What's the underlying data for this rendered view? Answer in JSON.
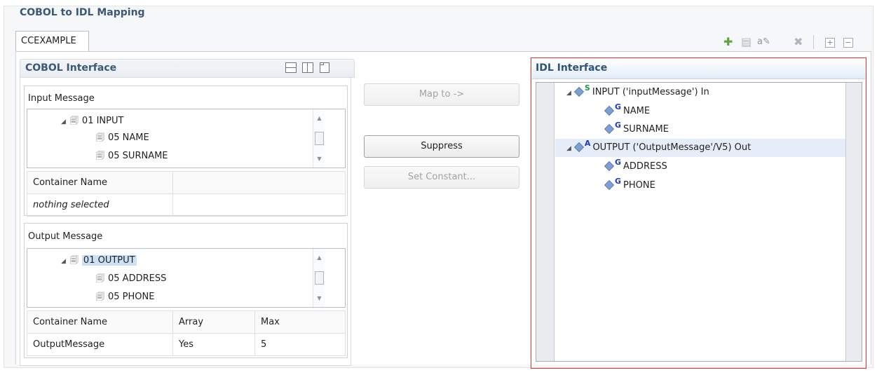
{
  "app": {
    "title": "COBOL to IDL Mapping"
  },
  "tabs": [
    {
      "label": "CCEXAMPLE"
    }
  ],
  "toolbar": {
    "icons": [
      "add-icon",
      "copy-icon",
      "rename-icon",
      "delete-icon",
      "expand-all-icon",
      "collapse-all-icon"
    ]
  },
  "cobol": {
    "title": "COBOL Interface",
    "input_message": {
      "label": "Input Message",
      "tree": [
        {
          "text": "01 INPUT",
          "level": 0,
          "expanded": true
        },
        {
          "text": "05  NAME",
          "level": 1
        },
        {
          "text": "05  SURNAME",
          "level": 1
        }
      ],
      "table": {
        "headers": [
          "Container Name",
          ""
        ],
        "rows": [
          [
            "nothing selected",
            ""
          ]
        ]
      }
    },
    "output_message": {
      "label": "Output Message",
      "tree": [
        {
          "text": "01  OUTPUT",
          "level": 0,
          "expanded": true,
          "selected": true
        },
        {
          "text": "05  ADDRESS",
          "level": 1
        },
        {
          "text": "05  PHONE",
          "level": 1
        }
      ],
      "table": {
        "headers": [
          "Container Name",
          "Array",
          "Max"
        ],
        "rows": [
          [
            "OutputMessage",
            "Yes",
            "5"
          ]
        ]
      }
    }
  },
  "buttons": {
    "map_to": "Map to ->",
    "suppress": "Suppress",
    "set_constant": "Set Constant..."
  },
  "idl": {
    "title": "IDL Interface",
    "tree": [
      {
        "badge": "S",
        "text": "INPUT  ('inputMessage')  In",
        "level": 0
      },
      {
        "badge": "G",
        "text": "NAME",
        "level": 1
      },
      {
        "badge": "G",
        "text": "SURNAME",
        "level": 1
      },
      {
        "badge": "A",
        "text": "OUTPUT  ('OutputMessage'/V5)  Out",
        "level": 0,
        "highlighted": true
      },
      {
        "badge": "G",
        "text": "ADDRESS",
        "level": 1
      },
      {
        "badge": "G",
        "text": "PHONE",
        "level": 1
      }
    ]
  },
  "colors": {
    "accent": "#3b5878",
    "selection": "#cbe1f6",
    "highlight_border": "#e3312d"
  }
}
